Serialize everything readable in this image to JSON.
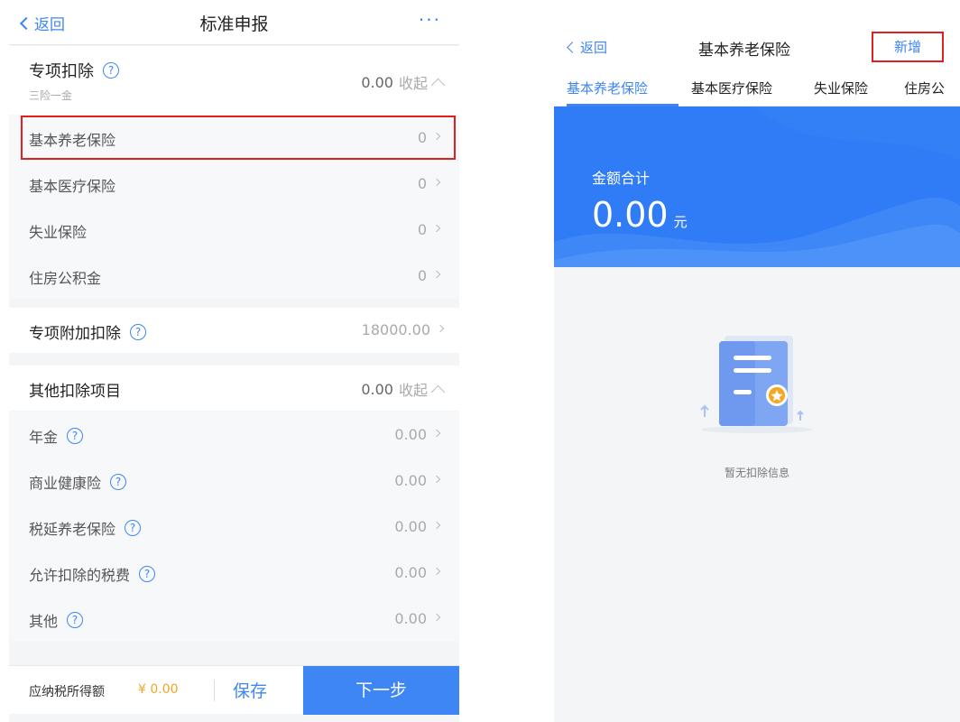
{
  "left": {
    "header": {
      "back_label": "返回",
      "title": "标准申报",
      "more_label": "···"
    },
    "special_deduction": {
      "title": "专项扣除",
      "subtitle": "三险一金",
      "amount": "0.00",
      "collapse_label": "收起",
      "items": [
        {
          "label": "基本养老保险",
          "value": "0"
        },
        {
          "label": "基本医疗保险",
          "value": "0"
        },
        {
          "label": "失业保险",
          "value": "0"
        },
        {
          "label": "住房公积金",
          "value": "0"
        }
      ]
    },
    "special_additional": {
      "title": "专项附加扣除",
      "amount": "18000.00"
    },
    "other_deduction": {
      "title": "其他扣除项目",
      "amount": "0.00",
      "collapse_label": "收起",
      "items": [
        {
          "label": "年金",
          "value": "0.00"
        },
        {
          "label": "商业健康险",
          "value": "0.00"
        },
        {
          "label": "税延养老保险",
          "value": "0.00"
        },
        {
          "label": "允许扣除的税费",
          "value": "0.00"
        },
        {
          "label": "其他",
          "value": "0.00"
        }
      ]
    },
    "footer": {
      "taxable_label": "应纳税所得额",
      "taxable_value": "¥ 0.00",
      "save_label": "保存",
      "next_label": "下一步"
    }
  },
  "right": {
    "header": {
      "back_label": "返回",
      "title": "基本养老保险",
      "add_label": "新增"
    },
    "tabs": [
      {
        "label": "基本养老保险",
        "active": true
      },
      {
        "label": "基本医疗保险",
        "active": false
      },
      {
        "label": "失业保险",
        "active": false
      },
      {
        "label": "住房公"
      }
    ],
    "banner": {
      "label": "金额合计",
      "amount": "0.00",
      "unit": "元"
    },
    "empty_text": "暂无扣除信息"
  },
  "colors": {
    "accent": "#3f86f5",
    "highlight_border": "#e02020",
    "banner": "#2f7cf6",
    "tax_value": "#f5a623"
  },
  "icons": {
    "help": "question-circle-icon",
    "chevron_right": "chevron-right-icon",
    "chevron_up": "chevron-up-icon",
    "back": "chevron-left-icon",
    "empty": "document-empty-icon"
  }
}
